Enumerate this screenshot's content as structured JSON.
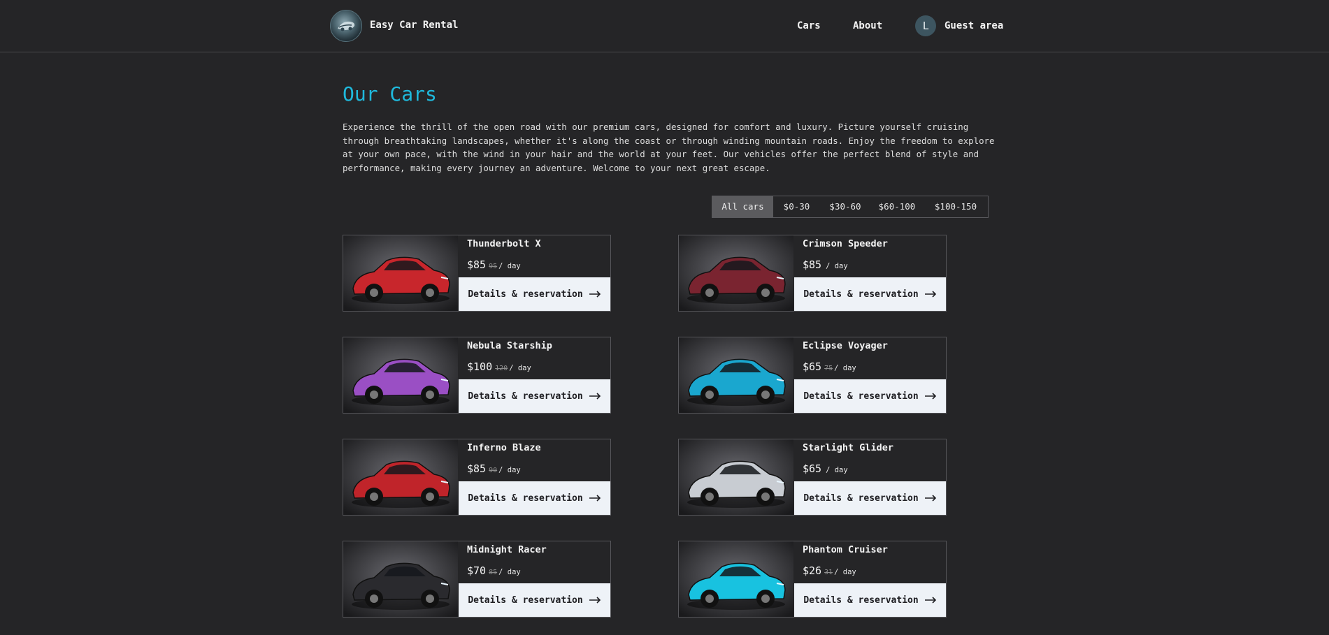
{
  "header": {
    "brand": "Easy Car Rental",
    "nav": [
      "Cars",
      "About"
    ],
    "avatar_initial": "L",
    "guest_area": "Guest area"
  },
  "main": {
    "title": "Our Cars",
    "intro": "Experience the thrill of the open road with our premium cars, designed for comfort and luxury. Picture yourself cruising through breathtaking landscapes, whether it's along the coast or through winding mountain roads. Enjoy the freedom to explore at your own pace, with the wind in your hair and the world at your feet. Our vehicles offer the perfect blend of style and performance, making every journey an adventure. Welcome to your next great escape."
  },
  "filters": {
    "options": [
      "All cars",
      "$0-30",
      "$30-60",
      "$60-100",
      "$100-150"
    ],
    "active": "All cars"
  },
  "per_day": "/ day",
  "details_label": "Details & reservation",
  "cars": [
    {
      "name": "Thunderbolt X",
      "price": "$85",
      "old_price": "95",
      "color": "#c8262c"
    },
    {
      "name": "Crimson Speeder",
      "price": "$85",
      "old_price": "",
      "color": "#7a2430"
    },
    {
      "name": "Nebula Starship",
      "price": "$100",
      "old_price": "120",
      "color": "#9a4fc4"
    },
    {
      "name": "Eclipse Voyager",
      "price": "$65",
      "old_price": "75",
      "color": "#1aa7cf"
    },
    {
      "name": "Inferno Blaze",
      "price": "$85",
      "old_price": "90",
      "color": "#c0242a"
    },
    {
      "name": "Starlight Glider",
      "price": "$65",
      "old_price": "",
      "color": "#c8ccd2"
    },
    {
      "name": "Midnight Racer",
      "price": "$70",
      "old_price": "85",
      "color": "#2a2a2e"
    },
    {
      "name": "Phantom Cruiser",
      "price": "$26",
      "old_price": "31",
      "color": "#18c2e0"
    }
  ]
}
